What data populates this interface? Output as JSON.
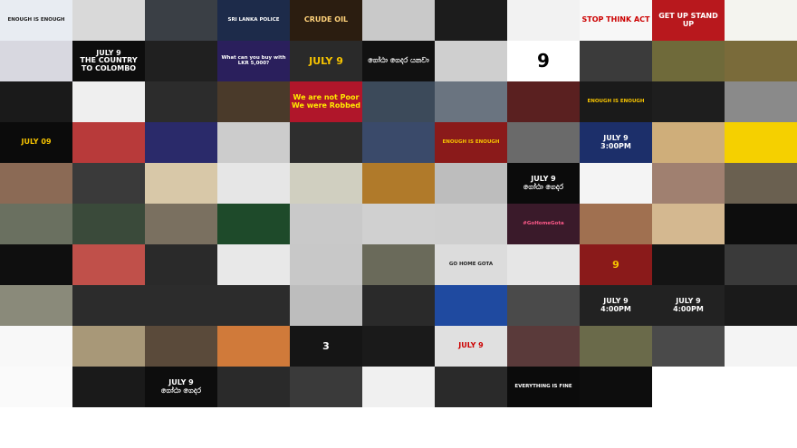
{
  "layout": {
    "cols": 11
  },
  "tiles": [
    {
      "bg": "#e8ecf2",
      "fg": "#222",
      "text": "ENOUGH IS ENOUGH",
      "size": "s"
    },
    {
      "bg": "#d9d9d9",
      "fg": "#222",
      "text": "",
      "size": "s"
    },
    {
      "bg": "#3a3f45",
      "fg": "#fff",
      "text": "",
      "size": "s"
    },
    {
      "bg": "#1d2b4a",
      "fg": "#fff",
      "text": "SRI LANKA POLICE",
      "size": "s"
    },
    {
      "bg": "#2b1d10",
      "fg": "#ffd27a",
      "text": "CRUDE OIL",
      "size": "m"
    },
    {
      "bg": "#c9c9c9",
      "fg": "#222",
      "text": "",
      "size": "s"
    },
    {
      "bg": "#1c1c1c",
      "fg": "#ddd",
      "text": "",
      "size": "s"
    },
    {
      "bg": "#f2f2f2",
      "fg": "#333",
      "text": "",
      "size": "s"
    },
    {
      "bg": "#f7f7f7",
      "fg": "#c00",
      "text": "STOP THINK ACT",
      "size": "m"
    },
    {
      "bg": "#b8181d",
      "fg": "#fff",
      "text": "GET UP STAND UP",
      "size": "m"
    },
    {
      "bg": "#f4f4ef",
      "fg": "#333",
      "text": "",
      "size": "s"
    },
    {
      "bg": "#d8d8e0",
      "fg": "#222",
      "text": "",
      "size": "s"
    },
    {
      "bg": "#0d0d0d",
      "fg": "#fff",
      "text": "JULY 9\nTHE COUNTRY TO COLOMBO",
      "size": "m"
    },
    {
      "bg": "#202020",
      "fg": "#ddd",
      "text": "",
      "size": "s"
    },
    {
      "bg": "#2a1f5c",
      "fg": "#fff",
      "text": "What can you buy with LKR 5,000?",
      "size": "s"
    },
    {
      "bg": "#2a2a2a",
      "fg": "#f7c400",
      "text": "JULY 9",
      "size": "l"
    },
    {
      "bg": "#111",
      "fg": "#fff",
      "text": "ගෝඨා ගෙදර යනවා",
      "size": "m"
    },
    {
      "bg": "#cfcfcf",
      "fg": "#222",
      "text": "",
      "size": "s"
    },
    {
      "bg": "#ffffff",
      "fg": "#000",
      "text": "9",
      "size": "xl"
    },
    {
      "bg": "#3b3b3b",
      "fg": "#eee",
      "text": "",
      "size": "s"
    },
    {
      "bg": "#6f6a3a",
      "fg": "#fff",
      "text": "",
      "size": "s"
    },
    {
      "bg": "#7a6b3a",
      "fg": "#fff",
      "text": "",
      "size": "s"
    },
    {
      "bg": "#1a1a1a",
      "fg": "#eee",
      "text": "",
      "size": "s"
    },
    {
      "bg": "#efefef",
      "fg": "#333",
      "text": "",
      "size": "s"
    },
    {
      "bg": "#2c2c2c",
      "fg": "#ddd",
      "text": "",
      "size": "s"
    },
    {
      "bg": "#4a3a2a",
      "fg": "#eee",
      "text": "",
      "size": "s"
    },
    {
      "bg": "#b0162a",
      "fg": "#ffeb00",
      "text": "We are not Poor\nWe were Robbed",
      "size": "m"
    },
    {
      "bg": "#3c4a5a",
      "fg": "#fff",
      "text": "",
      "size": "s"
    },
    {
      "bg": "#6a7480",
      "fg": "#fff",
      "text": "",
      "size": "s"
    },
    {
      "bg": "#5a2020",
      "fg": "#fff",
      "text": "",
      "size": "s"
    },
    {
      "bg": "#1a1a1a",
      "fg": "#f7c400",
      "text": "ENOUGH IS ENOUGH",
      "size": "s"
    },
    {
      "bg": "#1e1e1e",
      "fg": "#ddd",
      "text": "",
      "size": "s"
    },
    {
      "bg": "#8a8a8a",
      "fg": "#fff",
      "text": "",
      "size": "s"
    },
    {
      "bg": "#0b0b0b",
      "fg": "#f7c400",
      "text": "JULY 09",
      "size": "m"
    },
    {
      "bg": "#b83a3a",
      "fg": "#fff",
      "text": "",
      "size": "s"
    },
    {
      "bg": "#2a2a6a",
      "fg": "#fff",
      "text": "",
      "size": "s"
    },
    {
      "bg": "#cccccc",
      "fg": "#222",
      "text": "",
      "size": "s"
    },
    {
      "bg": "#2e2e2e",
      "fg": "#ddd",
      "text": "",
      "size": "s"
    },
    {
      "bg": "#3a4a6a",
      "fg": "#fff",
      "text": "",
      "size": "s"
    },
    {
      "bg": "#8a1a1a",
      "fg": "#f7c400",
      "text": "ENOUGH IS ENOUGH",
      "size": "s"
    },
    {
      "bg": "#6a6a6a",
      "fg": "#fff",
      "text": "",
      "size": "s"
    },
    {
      "bg": "#1c2f6a",
      "fg": "#fff",
      "text": "JULY 9\n3:00PM",
      "size": "m"
    },
    {
      "bg": "#cfae7a",
      "fg": "#222",
      "text": "",
      "size": "s"
    },
    {
      "bg": "#f5d000",
      "fg": "#111",
      "text": "",
      "size": "s"
    },
    {
      "bg": "#8b6a55",
      "fg": "#fff",
      "text": "",
      "size": "s"
    },
    {
      "bg": "#3a3a3a",
      "fg": "#ddd",
      "text": "",
      "size": "s"
    },
    {
      "bg": "#d8c8a8",
      "fg": "#222",
      "text": "",
      "size": "s"
    },
    {
      "bg": "#e6e6e6",
      "fg": "#222",
      "text": "",
      "size": "s"
    },
    {
      "bg": "#d0cfc0",
      "fg": "#222",
      "text": "",
      "size": "s"
    },
    {
      "bg": "#b07a2a",
      "fg": "#fff",
      "text": "",
      "size": "s"
    },
    {
      "bg": "#bdbdbd",
      "fg": "#222",
      "text": "",
      "size": "s"
    },
    {
      "bg": "#0b0b0b",
      "fg": "#fff",
      "text": "JULY 9\nගෝඨා ගෙදර",
      "size": "m"
    },
    {
      "bg": "#f4f4f4",
      "fg": "#222",
      "text": "",
      "size": "s"
    },
    {
      "bg": "#a08070",
      "fg": "#fff",
      "text": "",
      "size": "s"
    },
    {
      "bg": "#6a6050",
      "fg": "#fff",
      "text": "",
      "size": "s"
    },
    {
      "bg": "#6a7060",
      "fg": "#fff",
      "text": "",
      "size": "s"
    },
    {
      "bg": "#3a4a3a",
      "fg": "#fff",
      "text": "",
      "size": "s"
    },
    {
      "bg": "#7a7060",
      "fg": "#fff",
      "text": "",
      "size": "s"
    },
    {
      "bg": "#1e4a2a",
      "fg": "#fff",
      "text": "",
      "size": "s"
    },
    {
      "bg": "#c9c9c9",
      "fg": "#222",
      "text": "",
      "size": "s"
    },
    {
      "bg": "#d0d0d0",
      "fg": "#222",
      "text": "",
      "size": "s"
    },
    {
      "bg": "#cfcfcf",
      "fg": "#222",
      "text": "",
      "size": "s"
    },
    {
      "bg": "#3a1a2a",
      "fg": "#ff5a8a",
      "text": "#GoHomeGota",
      "size": "s"
    },
    {
      "bg": "#a07050",
      "fg": "#fff",
      "text": "",
      "size": "s"
    },
    {
      "bg": "#d4b890",
      "fg": "#222",
      "text": "",
      "size": "s"
    },
    {
      "bg": "#0d0d0d",
      "fg": "#fff",
      "text": "",
      "size": "s"
    },
    {
      "bg": "#0f0f0f",
      "fg": "#fff",
      "text": "",
      "size": "s"
    },
    {
      "bg": "#c0504a",
      "fg": "#fff",
      "text": "",
      "size": "s"
    },
    {
      "bg": "#2a2a2a",
      "fg": "#ddd",
      "text": "",
      "size": "s"
    },
    {
      "bg": "#e8e8e8",
      "fg": "#222",
      "text": "",
      "size": "s"
    },
    {
      "bg": "#c8c8c8",
      "fg": "#222",
      "text": "",
      "size": "s"
    },
    {
      "bg": "#6a6a5a",
      "fg": "#fff",
      "text": "",
      "size": "s"
    },
    {
      "bg": "#dcdcdc",
      "fg": "#222",
      "text": "GO HOME GOTA",
      "size": "s"
    },
    {
      "bg": "#e6e6e6",
      "fg": "#222",
      "text": "",
      "size": "s"
    },
    {
      "bg": "#8a1a1a",
      "fg": "#f7c400",
      "text": "9",
      "size": "l"
    },
    {
      "bg": "#141414",
      "fg": "#f7c400",
      "text": "",
      "size": "s"
    },
    {
      "bg": "#3a3a3a",
      "fg": "#fff",
      "text": "",
      "size": "s"
    },
    {
      "bg": "#8a8a7a",
      "fg": "#fff",
      "text": "",
      "size": "s"
    },
    {
      "bg": "#2c2c2c",
      "fg": "#ddd",
      "text": "",
      "size": "s"
    },
    {
      "bg": "#2c2c2c",
      "fg": "#ddd",
      "text": "",
      "size": "s"
    },
    {
      "bg": "#2c2c2c",
      "fg": "#ddd",
      "text": "",
      "size": "s"
    },
    {
      "bg": "#bdbdbd",
      "fg": "#222",
      "text": "",
      "size": "s"
    },
    {
      "bg": "#2a2a2a",
      "fg": "#ddd",
      "text": "",
      "size": "s"
    },
    {
      "bg": "#1f4aa0",
      "fg": "#fff",
      "text": "",
      "size": "s"
    },
    {
      "bg": "#4a4a4a",
      "fg": "#fff",
      "text": "",
      "size": "s"
    },
    {
      "bg": "#222",
      "fg": "#fff",
      "text": "JULY 9\n4:00PM",
      "size": "m"
    },
    {
      "bg": "#222",
      "fg": "#fff",
      "text": "JULY 9\n4:00PM",
      "size": "m"
    },
    {
      "bg": "#1a1a1a",
      "fg": "#fff",
      "text": "",
      "size": "s"
    },
    {
      "bg": "#f8f8f8",
      "fg": "#000",
      "text": "",
      "size": "s"
    },
    {
      "bg": "#a89878",
      "fg": "#fff",
      "text": "",
      "size": "s"
    },
    {
      "bg": "#5a4a3a",
      "fg": "#fff",
      "text": "",
      "size": "s"
    },
    {
      "bg": "#d07a3a",
      "fg": "#fff",
      "text": "",
      "size": "s"
    },
    {
      "bg": "#151515",
      "fg": "#fff",
      "text": "3",
      "size": "l"
    },
    {
      "bg": "#1a1a1a",
      "fg": "#fff",
      "text": "",
      "size": "s"
    },
    {
      "bg": "#e0e0e0",
      "fg": "#c00",
      "text": "JULY 9",
      "size": "m"
    },
    {
      "bg": "#5a3a3a",
      "fg": "#fff",
      "text": "",
      "size": "s"
    },
    {
      "bg": "#6a6a4a",
      "fg": "#fff",
      "text": "",
      "size": "s"
    },
    {
      "bg": "#4a4a4a",
      "fg": "#fff",
      "text": "",
      "size": "s"
    },
    {
      "bg": "#f4f4f4",
      "fg": "#222",
      "text": "",
      "size": "s"
    },
    {
      "bg": "#fafafa",
      "fg": "#111",
      "text": "",
      "size": "s"
    },
    {
      "bg": "#1a1a1a",
      "fg": "#ddd",
      "text": "",
      "size": "s"
    },
    {
      "bg": "#0d0d0d",
      "fg": "#fff",
      "text": "JULY 9\nගෝඨා ගෙදර",
      "size": "m"
    },
    {
      "bg": "#2a2a2a",
      "fg": "#fff",
      "text": "",
      "size": "s"
    },
    {
      "bg": "#3a3a3a",
      "fg": "#fff",
      "text": "",
      "size": "s"
    },
    {
      "bg": "#f0f0f0",
      "fg": "#222",
      "text": "",
      "size": "s"
    },
    {
      "bg": "#2a2a2a",
      "fg": "#fff",
      "text": "",
      "size": "s"
    },
    {
      "bg": "#0b0b0b",
      "fg": "#fff",
      "text": "EVERYTHING IS FINE",
      "size": "s"
    },
    {
      "bg": "#0d0d0d",
      "fg": "#fff",
      "text": "",
      "size": "s"
    },
    {
      "bg": "#ffffff",
      "fg": "#222",
      "text": "",
      "size": "s"
    },
    {
      "bg": "#ffffff",
      "fg": "#222",
      "text": "",
      "size": "s"
    }
  ]
}
